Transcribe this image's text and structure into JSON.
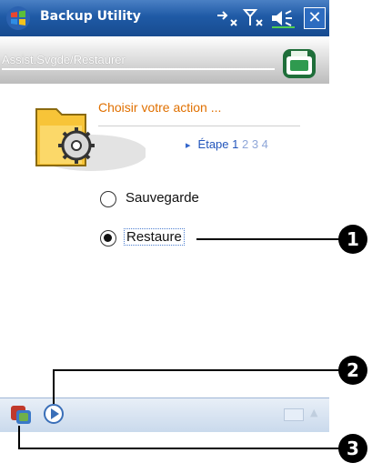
{
  "title_bar": {
    "app_title": "Backup Utility",
    "icons": [
      "start-logo-icon",
      "connectivity-icon",
      "antenna-icon",
      "speaker-icon"
    ],
    "close_label": "✕"
  },
  "header": {
    "wizard_title": "Assist.Svgde/Restaurer",
    "app_icon": "backup-box-icon"
  },
  "content": {
    "prompt": "Choisir votre action ...",
    "steps": {
      "label": "Étape",
      "current": "1",
      "others": "2 3 4"
    },
    "options": [
      {
        "label": "Sauvegarde",
        "selected": false
      },
      {
        "label": "Restaure",
        "selected": true
      }
    ]
  },
  "taskbar": {
    "icons": [
      "program-icon",
      "play-icon",
      "keyboard-icon",
      "up-arrow-icon"
    ],
    "keyboard_arrow": "▲"
  },
  "callouts": [
    "1",
    "2",
    "3"
  ],
  "colors": {
    "title_bar": "#1f5aa6",
    "prompt_text": "#e07000",
    "step_text": "#2255bb"
  }
}
